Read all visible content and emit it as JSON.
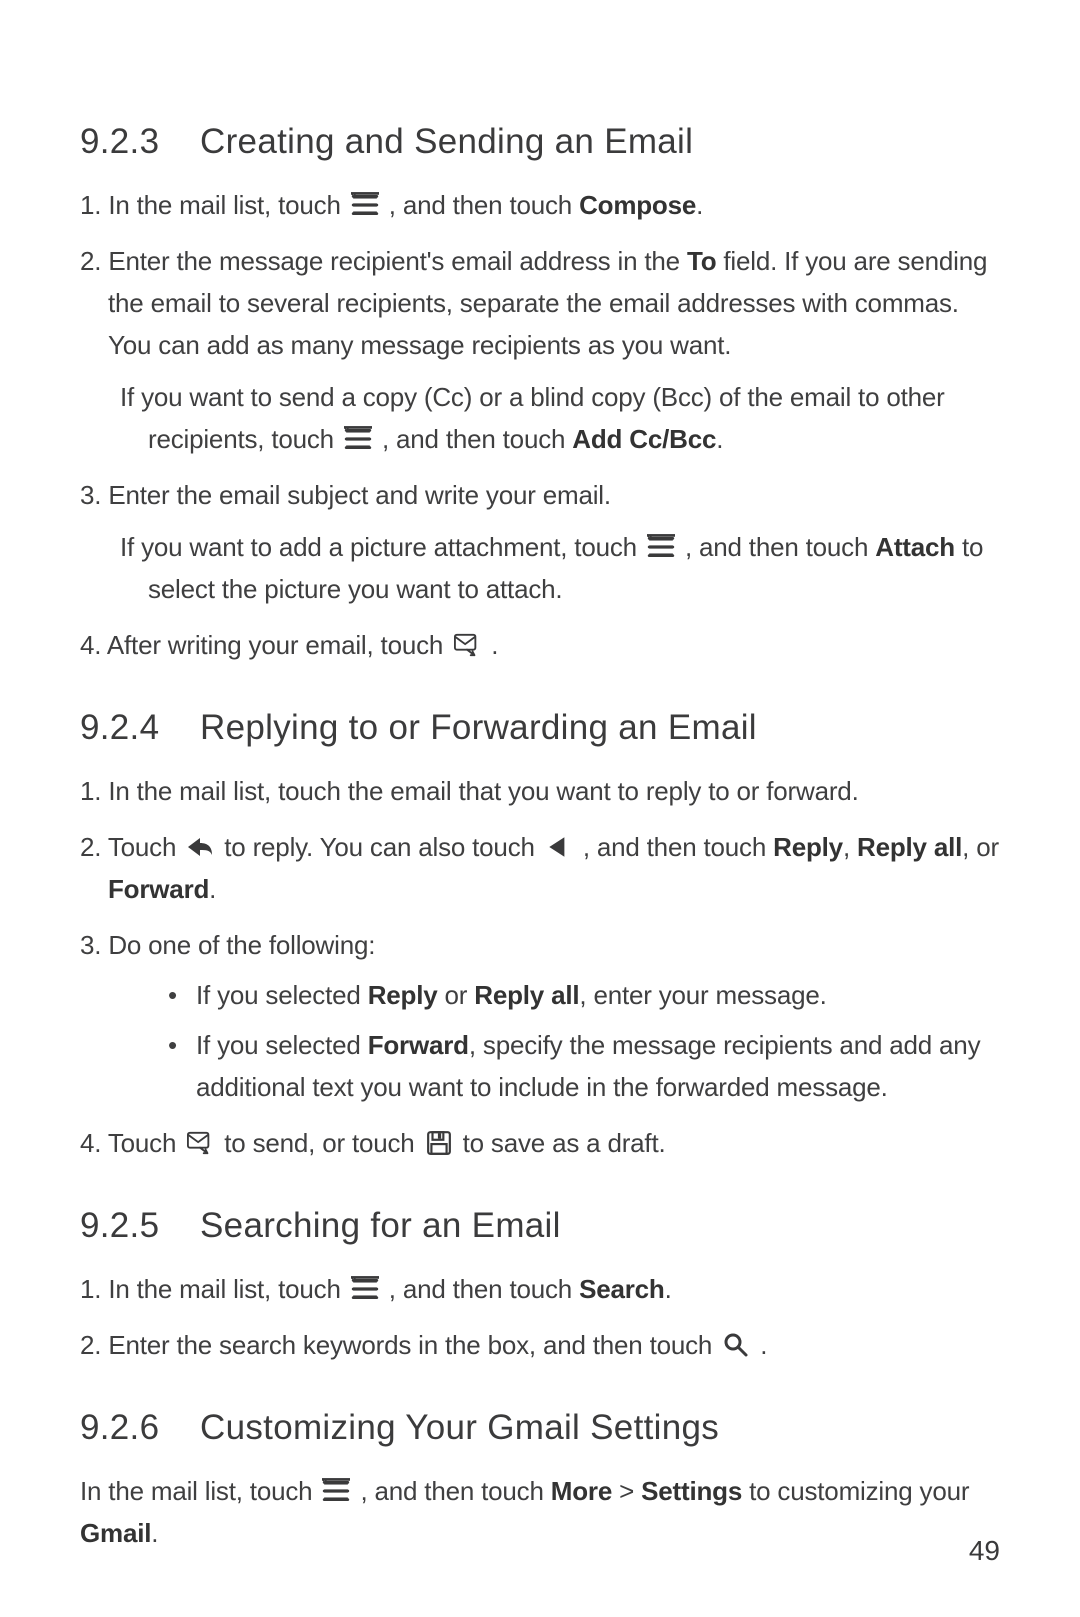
{
  "page_number": "49",
  "sections": {
    "s923": {
      "num": "9.2.3",
      "title": "Creating and Sending an Email",
      "step1_a": "In the mail list, touch ",
      "step1_b": " , and then touch ",
      "step1_bold1": "Compose",
      "step1_c": ".",
      "step2_a": "Enter the message recipient's email address in the ",
      "step2_bold1": "To",
      "step2_b": " field. If you are sending the email to several recipients, separate the email addresses with commas. You can add as many message recipients as you want.",
      "note1_a": "If you want to send a copy (Cc) or a blind copy (Bcc) of the email to other recipients, touch ",
      "note1_b": " , and then touch ",
      "note1_bold1": "Add Cc/Bcc",
      "note1_c": ".",
      "step3": "Enter the email subject and write your email.",
      "note2_a": "If you want to add a picture attachment, touch ",
      "note2_b": " , and then touch ",
      "note2_bold1": "Attach",
      "note2_c": " to select the picture you want to attach.",
      "step4_a": "After writing your email, touch ",
      "step4_b": " ."
    },
    "s924": {
      "num": "9.2.4",
      "title": "Replying to or Forwarding an Email",
      "step1": "In the mail list, touch the email that you want to reply to or forward.",
      "step2_a": "Touch ",
      "step2_b": " to reply. You can also touch ",
      "step2_c": " , and then touch ",
      "step2_bold1": "Reply",
      "step2_sep1": ", ",
      "step2_bold2": "Reply all",
      "step2_sep2": ", or ",
      "step2_bold3": "Forward",
      "step2_d": ".",
      "step3": "Do one of the following:",
      "bullet1_a": "If you selected ",
      "bullet1_bold1": "Reply",
      "bullet1_b": " or ",
      "bullet1_bold2": "Reply all",
      "bullet1_c": ", enter your message.",
      "bullet2_a": "If you selected ",
      "bullet2_bold1": "Forward",
      "bullet2_b": ", specify the message recipients and add any additional text you want to include in the forwarded message.",
      "step4_a": "Touch ",
      "step4_b": " to send, or touch ",
      "step4_c": " to save as a draft."
    },
    "s925": {
      "num": "9.2.5",
      "title": "Searching for an Email",
      "step1_a": "In the mail list, touch ",
      "step1_b": " , and then touch ",
      "step1_bold1": "Search",
      "step1_c": ".",
      "step2_a": "Enter the search keywords in the box, and then touch ",
      "step2_b": " ."
    },
    "s926": {
      "num": "9.2.6",
      "title": "Customizing Your Gmail Settings",
      "para_a": "In the mail list, touch ",
      "para_b": " , and then touch ",
      "para_bold1": "More",
      "para_gt": " > ",
      "para_bold2": "Settings",
      "para_c": " to customizing your ",
      "para_bold3": "Gmail",
      "para_d": "."
    }
  },
  "icons": {
    "menu": "menu-icon",
    "send": "send-icon",
    "reply": "reply-icon",
    "back": "back-icon",
    "save": "save-icon",
    "search": "search-icon"
  }
}
